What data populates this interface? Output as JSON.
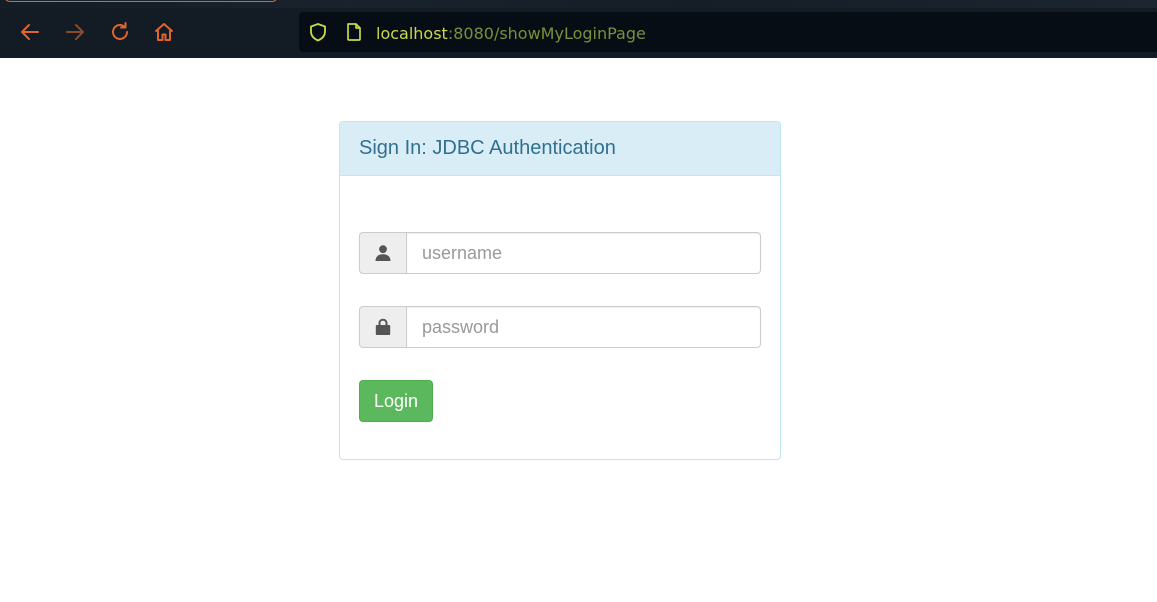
{
  "browser": {
    "url_host": "localhost",
    "url_rest": ":8080/showMyLoginPage",
    "icons": {
      "back": "back-arrow-icon",
      "forward": "forward-arrow-icon",
      "reload": "reload-icon",
      "home": "home-icon",
      "shield": "tracking-protection-shield-icon",
      "page": "page-info-icon"
    },
    "colors": {
      "toolbar_bg": "#131b24",
      "nav_icon": "#e0642e",
      "url_host": "#c8d94c",
      "url_rest": "#7c8f3a"
    }
  },
  "login_panel": {
    "title": "Sign In: JDBC Authentication",
    "username": {
      "icon": "user-icon",
      "placeholder": "username",
      "value": ""
    },
    "password": {
      "icon": "lock-icon",
      "placeholder": "password",
      "value": ""
    },
    "login_label": "Login",
    "colors": {
      "heading_bg": "#d9edf7",
      "heading_text": "#31708f",
      "border": "#bce8f1",
      "button_bg": "#5cb85c"
    }
  }
}
